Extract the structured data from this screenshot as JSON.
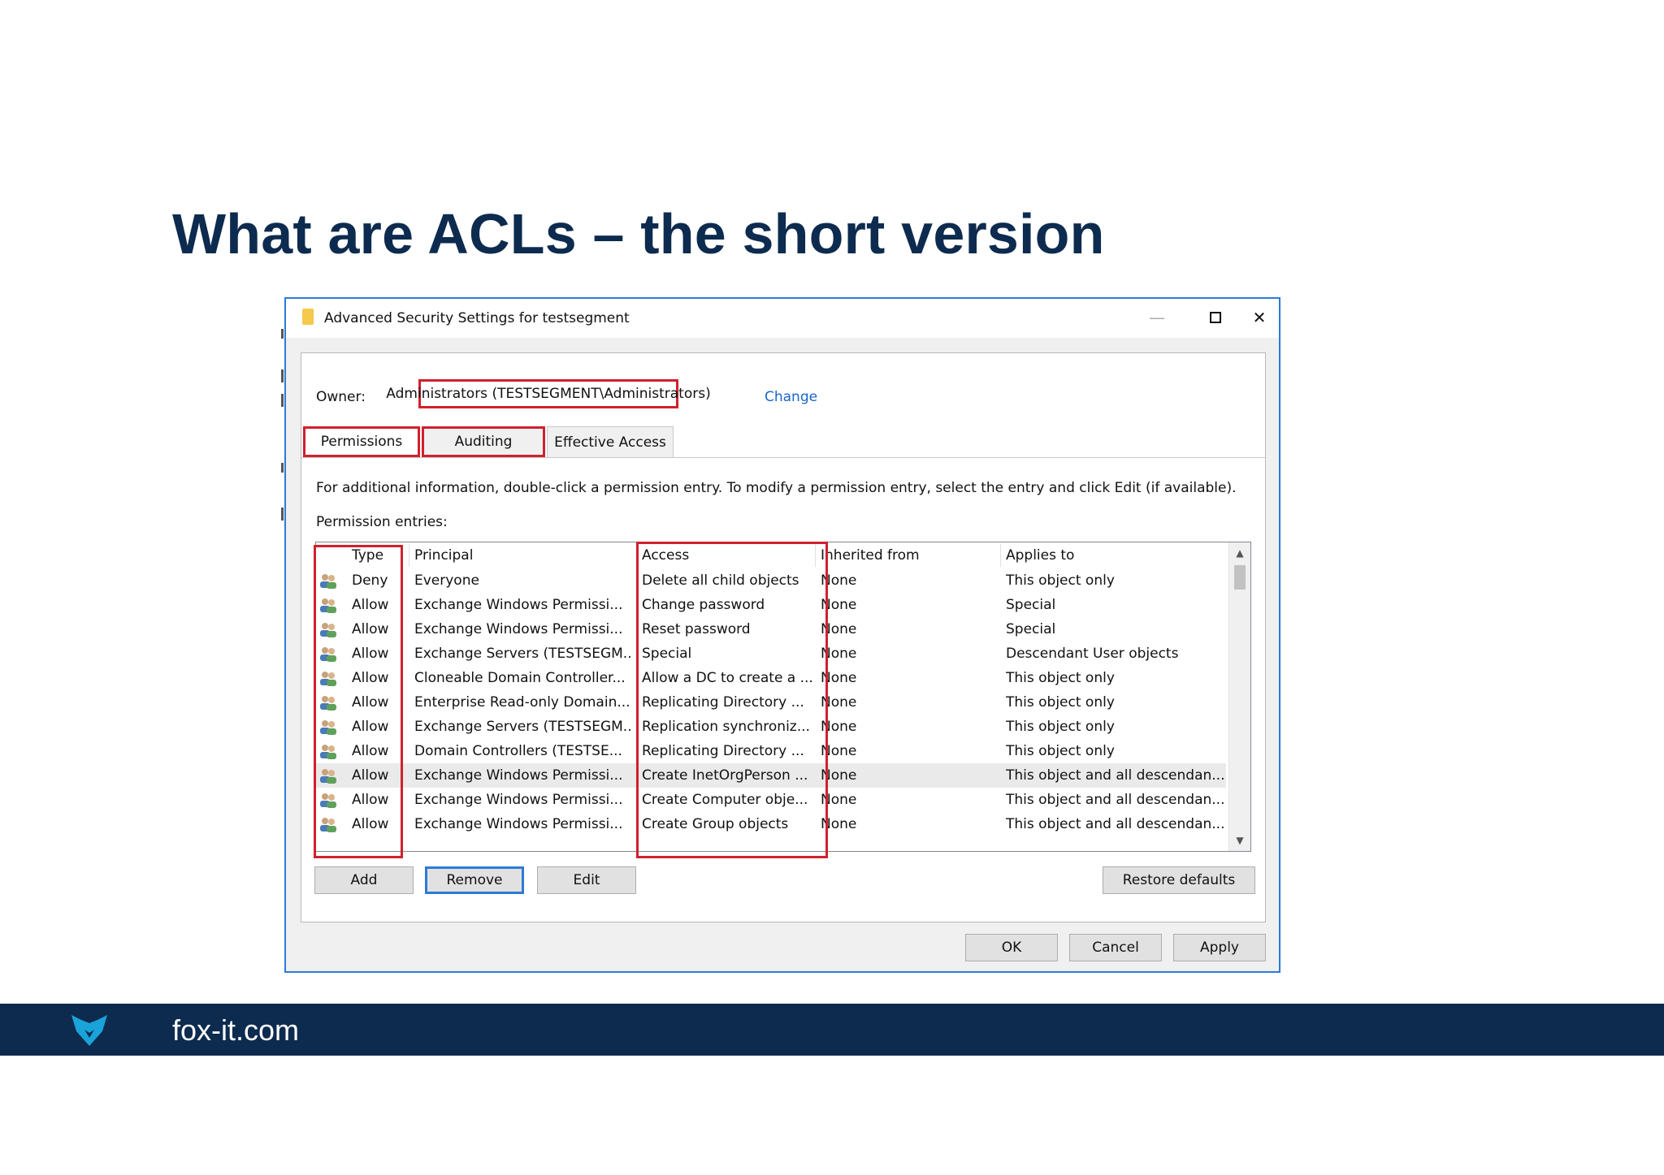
{
  "slide": {
    "title": "What are ACLs – the short version"
  },
  "dialog": {
    "title": "Advanced Security Settings for testsegment",
    "window_controls": {
      "minimize": "—",
      "close": "✕"
    },
    "owner": {
      "label": "Owner:",
      "value": "Administrators (TESTSEGMENT\\Administrators)",
      "change_link": "Change"
    },
    "tabs": [
      {
        "label": "Permissions",
        "selected": true
      },
      {
        "label": "Auditing",
        "selected": false
      },
      {
        "label": "Effective Access",
        "selected": false
      }
    ],
    "info_text": "For additional information, double-click a permission entry. To modify a permission entry, select the entry and click Edit (if available).",
    "entries_label": "Permission entries:",
    "columns": [
      "Type",
      "Principal",
      "Access",
      "Inherited from",
      "Applies to"
    ],
    "rows": [
      {
        "type": "Deny",
        "principal": "Everyone",
        "access": "Delete all child objects",
        "inherited": "None",
        "applies": "This object only"
      },
      {
        "type": "Allow",
        "principal": "Exchange Windows Permissi...",
        "access": "Change password",
        "inherited": "None",
        "applies": "Special"
      },
      {
        "type": "Allow",
        "principal": "Exchange Windows Permissi...",
        "access": "Reset password",
        "inherited": "None",
        "applies": "Special"
      },
      {
        "type": "Allow",
        "principal": "Exchange Servers (TESTSEGM...",
        "access": "Special",
        "inherited": "None",
        "applies": "Descendant User objects"
      },
      {
        "type": "Allow",
        "principal": "Cloneable Domain Controller...",
        "access": "Allow a DC to create a ...",
        "inherited": "None",
        "applies": "This object only"
      },
      {
        "type": "Allow",
        "principal": "Enterprise Read-only Domain...",
        "access": "Replicating Directory ...",
        "inherited": "None",
        "applies": "This object only"
      },
      {
        "type": "Allow",
        "principal": "Exchange Servers (TESTSEGM...",
        "access": "Replication synchroniz...",
        "inherited": "None",
        "applies": "This object only"
      },
      {
        "type": "Allow",
        "principal": "Domain Controllers (TESTSE...",
        "access": "Replicating Directory ...",
        "inherited": "None",
        "applies": "This object only"
      },
      {
        "type": "Allow",
        "principal": "Exchange Windows Permissi...",
        "access": "Create InetOrgPerson ...",
        "inherited": "None",
        "applies": "This object and all descendan..."
      },
      {
        "type": "Allow",
        "principal": "Exchange Windows Permissi...",
        "access": "Create Computer obje...",
        "inherited": "None",
        "applies": "This object and all descendan..."
      },
      {
        "type": "Allow",
        "principal": "Exchange Windows Permissi...",
        "access": "Create Group objects",
        "inherited": "None",
        "applies": "This object and all descendan..."
      }
    ],
    "selected_row_index": 8,
    "buttons": {
      "add": "Add",
      "remove": "Remove",
      "edit": "Edit",
      "restore_defaults": "Restore defaults",
      "ok": "OK",
      "cancel": "Cancel",
      "apply": "Apply"
    }
  },
  "footer": {
    "text": "fox-it.com"
  },
  "colors": {
    "title": "#0d2b4f",
    "footer_bg": "#0d2b4f",
    "highlight": "#d0202e",
    "accent": "#2d7bd6",
    "logo": "#1aa3d9"
  },
  "icons": {
    "row_icon": "user-group-icon",
    "logo": "fox-logo-icon",
    "folder": "folder-icon"
  }
}
